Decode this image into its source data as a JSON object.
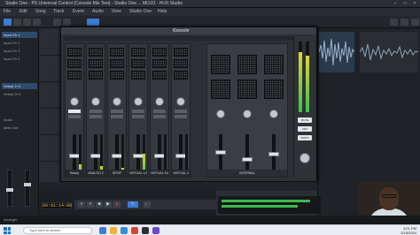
{
  "window": {
    "title": "Studio One - PS Universal Control (Console Mix Test) - Studio One ... MOJO - Hi-Fi Studio"
  },
  "menu": {
    "items": [
      "File",
      "Edit",
      "Song",
      "Track",
      "Event",
      "Audio",
      "View",
      "Studio One",
      "Help"
    ]
  },
  "left_panel": {
    "rows": [
      "Input Ch 1",
      "Input Ch 2",
      "Input Ch 3",
      "Input Ch 4",
      "Virtual 1+2",
      "Virtual 3+4",
      "Audio",
      "Main Out"
    ]
  },
  "console": {
    "title": "Console",
    "close_label": "×",
    "channels": [
      {
        "name": "Ready",
        "meter_level": 0.3
      },
      {
        "name": "ANALOG 2",
        "meter_level": 0.25
      },
      {
        "name": "SPDIF",
        "meter_level": 0.2
      },
      {
        "name": "VIRTUAL 1/2",
        "meter_level": 0.55
      },
      {
        "name": "VIRTUAL 3/4",
        "meter_level": 0.15
      },
      {
        "name": "VIRTUAL 4",
        "meter_level": 0.1
      }
    ],
    "monitor_label": "INTERNAL",
    "output_meter_left": 0.85,
    "output_meter_right": 0.8,
    "output_buttons": [
      "MUTE",
      "DIM",
      "MONO"
    ]
  },
  "transport": {
    "timecode": "00:01:14:00"
  },
  "statusbar": {
    "text": "Arranger"
  },
  "taskbar": {
    "search_placeholder": "Type here to search",
    "time": "3:21 PM",
    "date": "2/15/2024"
  },
  "colors": {
    "accent": "#3d7bd6",
    "meter_green": "#39c24b",
    "meter_yellow": "#e0d432",
    "record_red": "#e0433a"
  }
}
